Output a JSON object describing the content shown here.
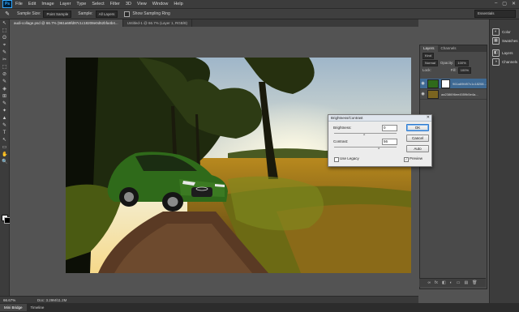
{
  "app": {
    "logo": "Ps"
  },
  "menu": [
    "File",
    "Edit",
    "Image",
    "Layer",
    "Type",
    "Select",
    "Filter",
    "3D",
    "View",
    "Window",
    "Help"
  ],
  "window_controls": [
    "–",
    "▢",
    "✕"
  ],
  "options": {
    "tool_icon": "eyedropper-icon",
    "tool_glyph": "✎",
    "sample_size_label": "Sample Size:",
    "sample_size_value": "Point Sample",
    "sample_label": "Sample:",
    "sample_value": "All Layers",
    "sampling_ring_label": "Show Sampling Ring",
    "workspace": "Essentials"
  },
  "tabs": [
    {
      "label": "audi-collage.psd @ 66.7% (961a69fd97c1c18208e0d52bfa4b4...",
      "active": true
    },
    {
      "label": "Untitled-1 @ 66.7% (Layer 1, RGB/8)",
      "active": false
    }
  ],
  "toolbar_glyphs": [
    "↖",
    "⬚",
    "ʘ",
    "⌖",
    "✎",
    "✂",
    "⬚",
    "⊘",
    "✎",
    "◈",
    "⊞",
    "✎",
    "✦",
    "▲",
    "✎",
    "T",
    "↖",
    "▭",
    "✋",
    "🔍"
  ],
  "status": {
    "zoom": "66.67%",
    "doc": "Doc: 3.29M/11.2M"
  },
  "bottom_tabs": [
    {
      "label": "Mini Bridge",
      "active": true
    },
    {
      "label": "Timeline",
      "active": false
    }
  ],
  "dock": [
    {
      "label": "Color",
      "icon": "color-icon",
      "glyph": "◐"
    },
    {
      "label": "Swatches",
      "icon": "swatches-icon",
      "glyph": "▦"
    },
    {
      "label": "Layers",
      "icon": "layers-icon",
      "glyph": "◧"
    },
    {
      "label": "Channels",
      "icon": "channels-icon",
      "glyph": "◑"
    }
  ],
  "layers_panel": {
    "tabs": [
      "Layers",
      "Channels"
    ],
    "kind": "Kind",
    "blend_mode": "Normal",
    "opacity_label": "Opacity:",
    "opacity_value": "100%",
    "lock_label": "Lock:",
    "fill_label": "Fill:",
    "fill_value": "100%",
    "layers": [
      {
        "name": "961a69fd97c1c18208...",
        "selected": true,
        "has_mask": true
      },
      {
        "name": "aa238696ee4559b5e4a...",
        "selected": false,
        "has_mask": false
      }
    ],
    "footer_icons": [
      "∞",
      "fx",
      "◧",
      "◐",
      "▭",
      "▤",
      "🗑"
    ]
  },
  "dialog": {
    "title": "Brightness/Contrast",
    "close_glyph": "✕",
    "brightness_label": "Brightness:",
    "brightness_value": "0",
    "contrast_label": "Contrast:",
    "contrast_value": "56",
    "ok_label": "OK",
    "cancel_label": "Cancel",
    "auto_label": "Auto",
    "legacy_label": "Use Legacy",
    "preview_label": "Preview",
    "preview_checked": "✓"
  }
}
